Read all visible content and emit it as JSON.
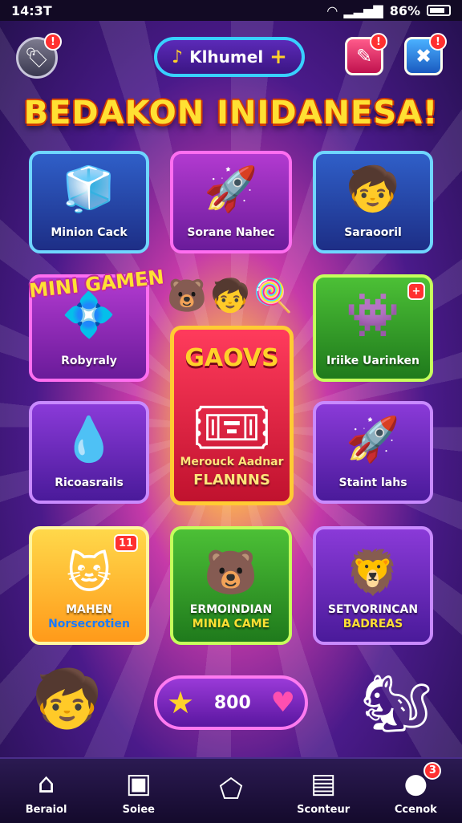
{
  "status_bar": {
    "time": "14:3T",
    "battery": "86%"
  },
  "header": {
    "music_pill_label": "Klhumel",
    "left_badge": "!",
    "right_badge_1": "!",
    "right_badge_2": "!"
  },
  "title": "BEDAKON INIDANESA!",
  "mini_games_banner": "MINI GAMEN",
  "cards": {
    "c1": "Minion Cack",
    "c2": "Sorane Nahec",
    "c3": "Saraooril",
    "c4": "Robyraly",
    "c5": "Iriike Uarinken",
    "c6": "Ricoasrails",
    "c7": "Staint lahs",
    "c8_a": "MAHEN",
    "c8_b": "Norsecrotien",
    "c9_a": "ERMOINDIAN",
    "c9_b": "MINIA CAME",
    "c10_a": "SETVORINCAN",
    "c10_b": "BADREAS",
    "c8_badge": "11"
  },
  "featured": {
    "title": "GAOVS",
    "label_1": "Merouck Aadnar",
    "label_2": "FLANNNS"
  },
  "coins": {
    "value": "800"
  },
  "nav": {
    "home": "Beraiol",
    "store": "Soiee",
    "center": "",
    "counter": "Sconteur",
    "chat": "Ccenok",
    "chat_badge": "3"
  },
  "colors": {
    "accent": "#ffd12a",
    "title_outline": "#d23a00",
    "nav_bg": "#1c0f3a"
  }
}
